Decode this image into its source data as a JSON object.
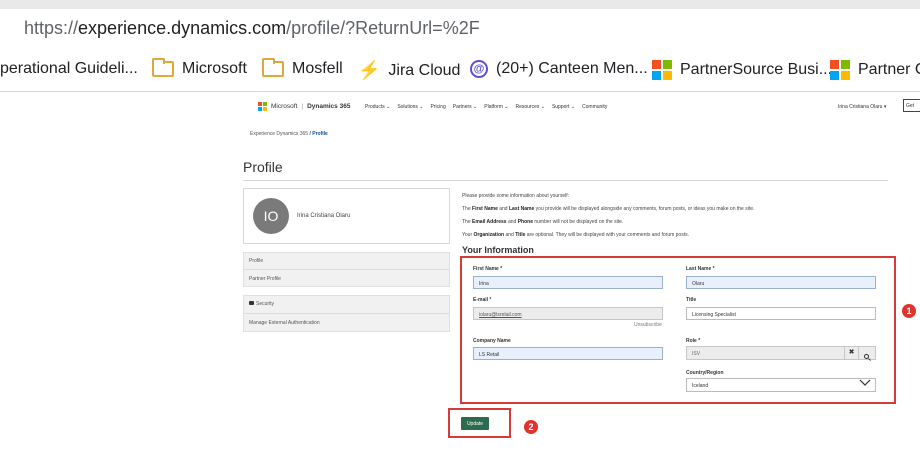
{
  "browser": {
    "url_prefix": "https://",
    "url_domain": "experience.dynamics.com",
    "url_rest": "/profile/?ReturnUrl=%2F"
  },
  "bookmarks": [
    {
      "label": "perational Guideli...",
      "icon": "folder-icon"
    },
    {
      "label": "Microsoft",
      "icon": "folder-icon"
    },
    {
      "label": "Mosfell",
      "icon": "folder-icon"
    },
    {
      "label": "Jira Cloud",
      "icon": "jira-icon"
    },
    {
      "label": "(20+) Canteen Men...",
      "icon": "canteen-icon"
    },
    {
      "label": "PartnerSource Busi...",
      "icon": "microsoft-logo-icon"
    },
    {
      "label": "Partner C",
      "icon": "microsoft-logo-icon"
    }
  ],
  "site": {
    "brand_microsoft": "Microsoft",
    "brand_product": "Dynamics 365",
    "nav": [
      "Products ⌄",
      "Solutions ⌄",
      "Pricing",
      "Partners ⌄",
      "Platform ⌄",
      "Resources ⌄",
      "Support ⌄",
      "Community"
    ],
    "user_name": "Irina Cristiana Olaru ▾",
    "get_button": "Get"
  },
  "breadcrumb": {
    "home": "Experience Dynamics 365",
    "sep": "/",
    "current": "Profile"
  },
  "page_title": "Profile",
  "profile_card": {
    "initials": "IO",
    "name": "Irina Cristiana Olaru"
  },
  "left_menu": {
    "profile": "Profile",
    "partner_profile": "Partner Profile",
    "security": "Security",
    "manage_external_auth": "Manage External Authentication"
  },
  "info": {
    "line1": "Please provide some information about yourself:",
    "line2_a": "The ",
    "line2_b": "First Name",
    "line2_c": " and ",
    "line2_d": "Last Name",
    "line2_e": " you provide will be displayed alongside any comments, forum posts, or ideas you make on the site.",
    "line3_a": "The ",
    "line3_b": "Email Address",
    "line3_c": " and ",
    "line3_d": "Phone",
    "line3_e": " number will not be displayed on the site.",
    "line4_a": "Your ",
    "line4_b": "Organization",
    "line4_c": " and ",
    "line4_d": "Title",
    "line4_e": " are optional. They will be displayed with your comments and forum posts.",
    "section_title": "Your Information"
  },
  "form": {
    "first_name_label": "First Name *",
    "first_name_value": "Irina",
    "last_name_label": "Last Name *",
    "last_name_value": "Olaru",
    "email_label": "E-mail *",
    "email_value": "iolaru@lsretail.com",
    "unsubscribe": "Unsubscribe",
    "title_label": "Title",
    "title_value": "Licensing Specialist",
    "company_label": "Company Name",
    "company_value": "LS Retail",
    "role_label": "Role *",
    "role_value": "ISV",
    "role_clear": "✖",
    "country_label": "Country/Region",
    "country_value": "Iceland"
  },
  "update_button": "Update",
  "annotations": {
    "badge1": "1",
    "badge2": "2"
  },
  "colors": {
    "highlight_red": "#d83a3a",
    "update_green": "#2d6b4f",
    "badge_red": "#e0322e"
  }
}
